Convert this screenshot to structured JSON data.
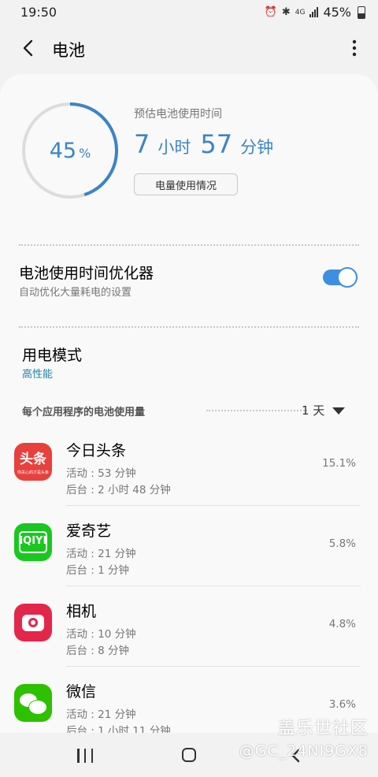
{
  "status_bar": {
    "time": "19:50",
    "alarm_icon": "alarm-icon",
    "bluetooth_icon": "bluetooth-icon",
    "network": "4G",
    "battery": "45%"
  },
  "app_bar": {
    "title": "电池"
  },
  "battery": {
    "level_number": "45",
    "level_unit": "%",
    "level_fraction": 0.45,
    "est_label": "预估电池使用时间",
    "hours": "7",
    "hours_unit": "小时",
    "minutes": "57",
    "minutes_unit": "分钟",
    "usage_button": "电量使用情况"
  },
  "optimizer": {
    "title": "电池使用时间优化器",
    "subtitle": "自动优化大量耗电的设置",
    "enabled": true
  },
  "power_mode": {
    "title": "用电模式",
    "value": "高性能"
  },
  "usage_section": {
    "label": "每个应用程序的电池使用量",
    "period": "1 天"
  },
  "apps": [
    {
      "name": "今日头条",
      "active": "活动 : 53 分钟",
      "background": "后台 : 2 小时 48 分钟",
      "percent": "15.1%",
      "icon_text": "头条",
      "icon_sub": "你关心的才是头条"
    },
    {
      "name": "爱奇艺",
      "active": "活动 : 21 分钟",
      "background": "后台 : 1 分钟",
      "percent": "5.8%",
      "icon_text": "iQIYI"
    },
    {
      "name": "相机",
      "active": "活动 : 10 分钟",
      "background": "后台 : 8 分钟",
      "percent": "4.8%"
    },
    {
      "name": "微信",
      "active": "活动 : 21 分钟",
      "background": "后台 : 1 小时 11 分钟",
      "percent": "3.6%"
    }
  ],
  "watermark": {
    "line1": "盖乐世社区",
    "line2": "@GC_24NI9GX8"
  },
  "colors": {
    "accent": "#3b84c8",
    "toggle": "#3d8fe0",
    "link": "#1e7fa8"
  }
}
